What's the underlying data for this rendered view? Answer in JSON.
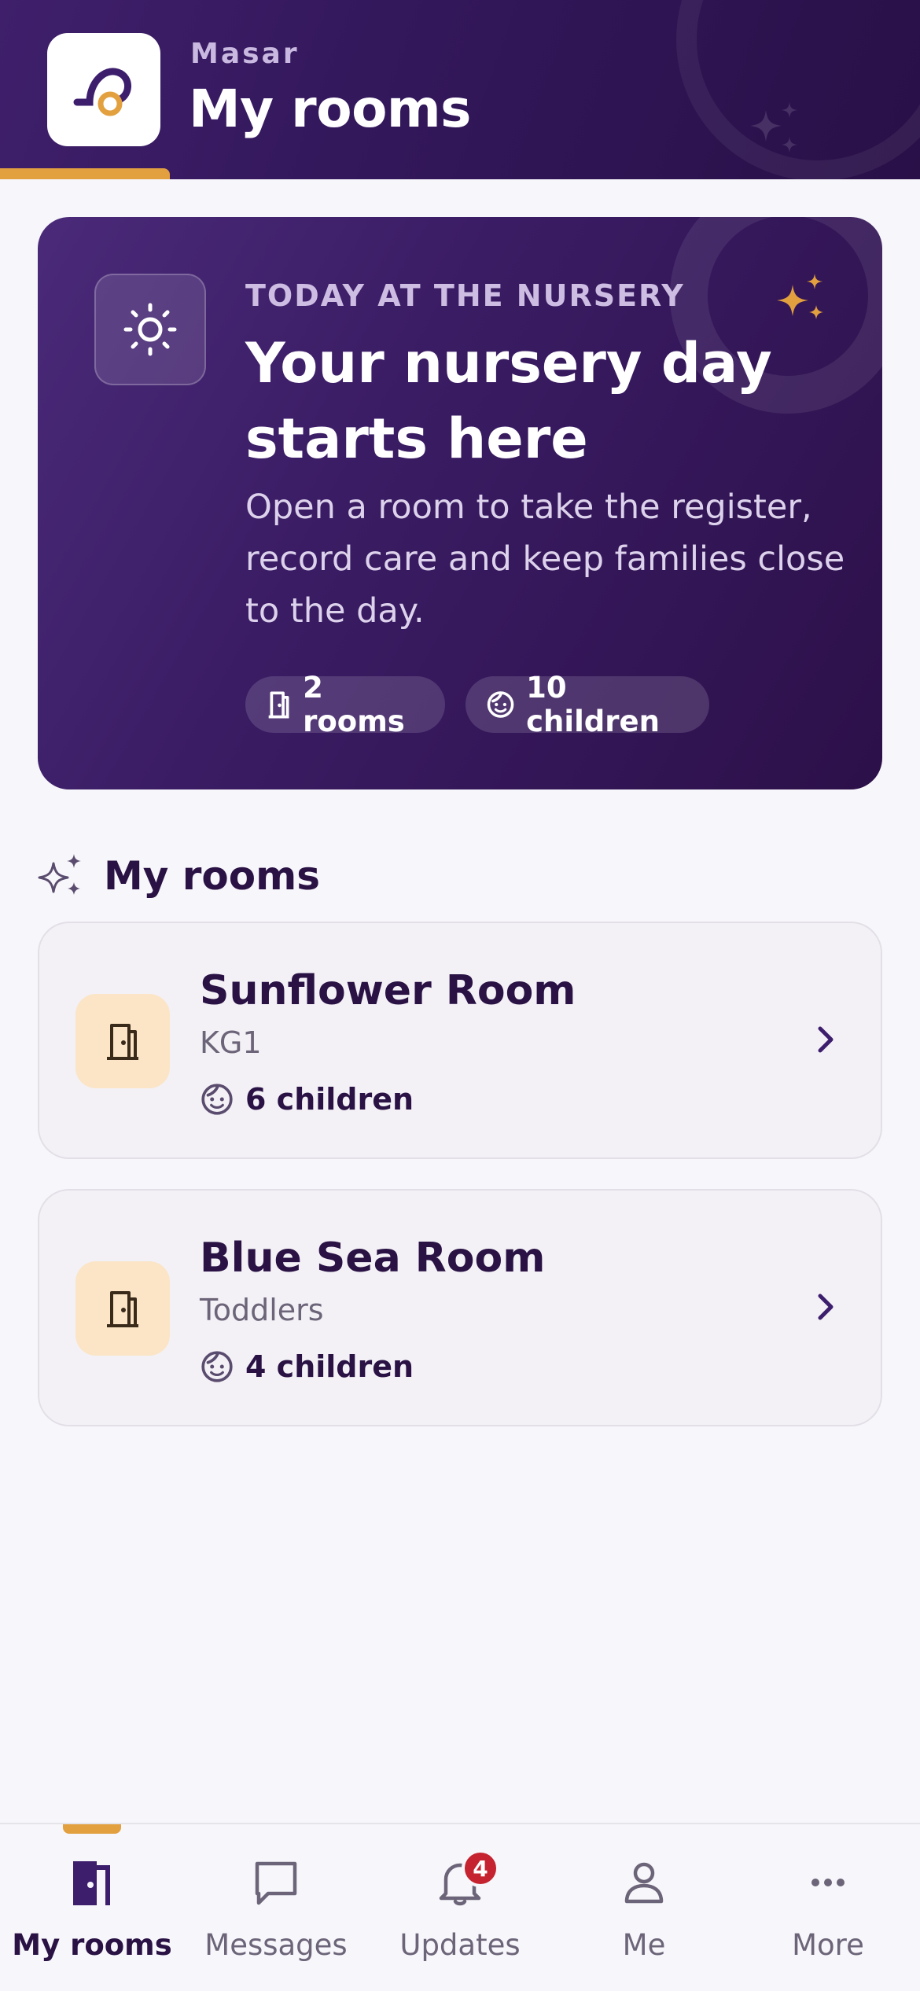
{
  "header": {
    "app_name": "Masar",
    "title": "My rooms",
    "logo_icon": "masar-logo-icon"
  },
  "hero": {
    "eyebrow": "TODAY AT THE NURSERY",
    "title": "Your nursery day starts here",
    "description": "Open a room to take the register, record care and keep families close to the day.",
    "icon": "sun-icon",
    "rooms_chip": "2 rooms",
    "children_chip": "10 children"
  },
  "section": {
    "title": "My rooms",
    "icon": "sparkles-icon"
  },
  "rooms": [
    {
      "name": "Sunflower Room",
      "group": "KG1",
      "children": "6 children"
    },
    {
      "name": "Blue Sea Room",
      "group": "Toddlers",
      "children": "4 children"
    }
  ],
  "nav": {
    "items": [
      {
        "label": "My rooms",
        "icon": "door-icon",
        "active": true
      },
      {
        "label": "Messages",
        "icon": "message-icon",
        "active": false
      },
      {
        "label": "Updates",
        "icon": "bell-icon",
        "active": false,
        "badge": "4"
      },
      {
        "label": "Me",
        "icon": "person-icon",
        "active": false
      },
      {
        "label": "More",
        "icon": "more-icon",
        "active": false
      }
    ]
  },
  "colors": {
    "brand_purple": "#32175a",
    "accent_orange": "#e2a03f",
    "badge_red": "#c4232f",
    "room_icon_bg": "#fbe5c6"
  }
}
